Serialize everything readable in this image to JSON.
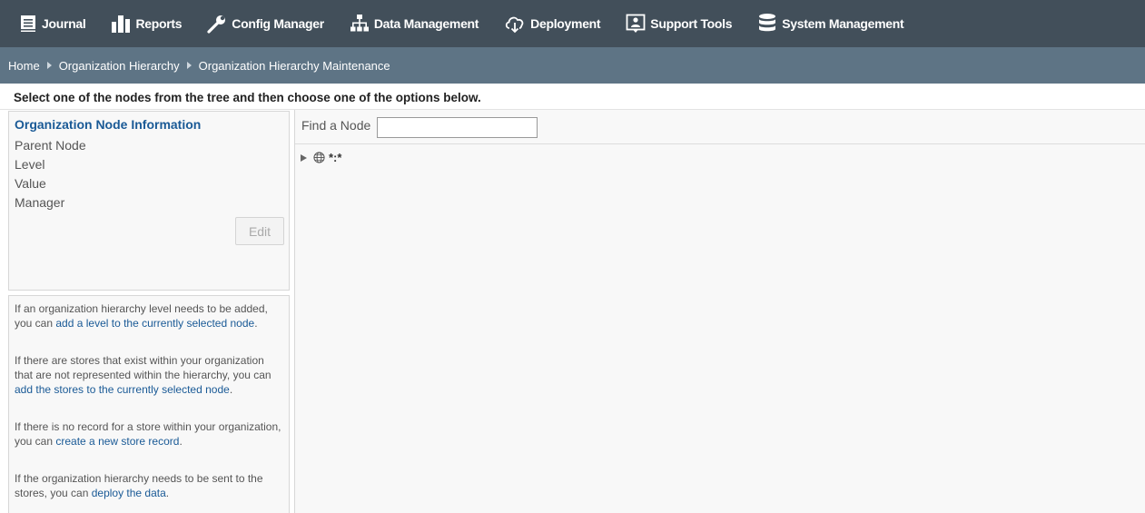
{
  "nav": {
    "items": [
      {
        "label": "Journal",
        "icon": "journal-icon"
      },
      {
        "label": "Reports",
        "icon": "bar-chart-icon"
      },
      {
        "label": "Config Manager",
        "icon": "wrench-icon"
      },
      {
        "label": "Data Management",
        "icon": "hierarchy-icon"
      },
      {
        "label": "Deployment",
        "icon": "cloud-download-icon"
      },
      {
        "label": "Support Tools",
        "icon": "support-icon"
      },
      {
        "label": "System Management",
        "icon": "database-icon"
      }
    ]
  },
  "breadcrumb": {
    "items": [
      "Home",
      "Organization Hierarchy",
      "Organization Hierarchy Maintenance"
    ]
  },
  "instructions": "Select one of the nodes from the tree and then choose one of the options below.",
  "info": {
    "title": "Organization Node Information",
    "fields": [
      "Parent Node",
      "Level",
      "Value",
      "Manager"
    ],
    "edit_label": "Edit"
  },
  "help": {
    "p1_text": "If an organization hierarchy level needs to be added, you can ",
    "p1_link": "add a level to the currently selected node",
    "p2_text": "If there are stores that exist within your organization that are not represented within the hierarchy, you can ",
    "p2_link": "add the stores to the currently selected node",
    "p3_text": "If there is no record for a store within your organization, you can ",
    "p3_link": "create a new store record",
    "p4_text": "If the organization hierarchy needs to be sent to the stores, you can ",
    "p4_link": "deploy the data",
    "period": "."
  },
  "tree": {
    "find_label": "Find a Node",
    "find_value": "",
    "root_label": "*:*"
  },
  "colors": {
    "nav_bg": "#424f5a",
    "breadcrumb_bg": "#5e7485",
    "link": "#1a5a96"
  }
}
